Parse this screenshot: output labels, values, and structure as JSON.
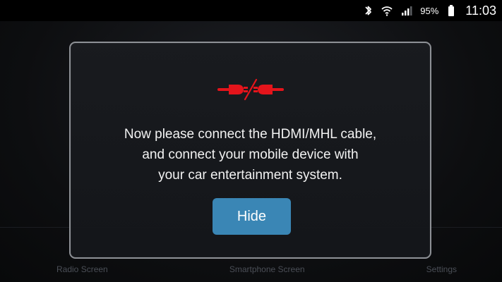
{
  "status_bar": {
    "battery_percent": "95%",
    "time": "11:03",
    "icons": [
      "bluetooth-icon",
      "wifi-icon",
      "signal-icon",
      "battery-icon"
    ]
  },
  "dialog": {
    "message": "Now please connect the HDMI/MHL cable,\nand connect your mobile device with\nyour car entertainment system.",
    "hide_label": "Hide",
    "icon": "disconnected-plug-icon",
    "accent_color": "#e4141b",
    "button_color": "#3a86b5"
  },
  "bottom_nav": {
    "items": [
      {
        "label": "Radio Screen"
      },
      {
        "label": "Smartphone Screen"
      },
      {
        "label": "Settings"
      }
    ]
  }
}
